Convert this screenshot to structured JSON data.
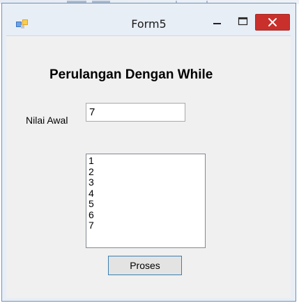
{
  "window": {
    "title": "Form5",
    "close_color": "#c9302c",
    "frame_color": "#e8eef6"
  },
  "icons": {
    "app_icon": "windows-form-icon",
    "minimize": "minimize-icon",
    "maximize": "maximize-icon",
    "close": "close-icon"
  },
  "form": {
    "heading": "Perulangan Dengan While",
    "nilai_label": "Nilai Awal",
    "nilai_value": "7",
    "list_items": [
      "1",
      "2",
      "3",
      "4",
      "5",
      "6",
      "7"
    ],
    "button_label": "Proses"
  }
}
